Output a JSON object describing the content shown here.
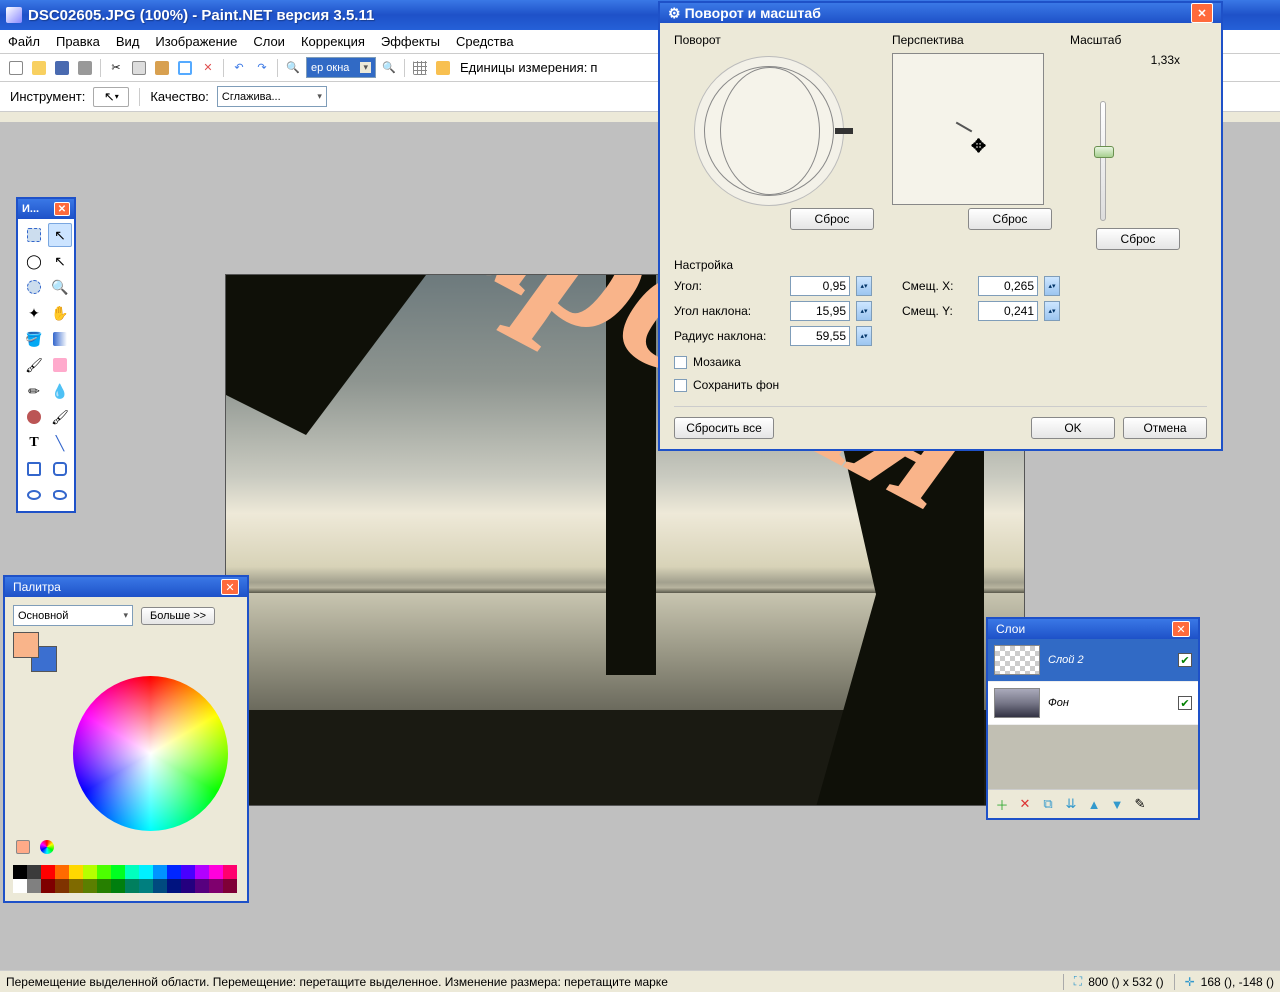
{
  "main_title": "DSC02605.JPG (100%) - Paint.NET версия 3.5.11",
  "menu": {
    "file": "Файл",
    "edit": "Правка",
    "view": "Вид",
    "image": "Изображение",
    "layers": "Слои",
    "adjust": "Коррекция",
    "effects": "Эффекты",
    "tools": "Средства"
  },
  "toolbar": {
    "zoom_value": "ер окна",
    "units_label": "Единицы измерения:",
    "units_short": "п"
  },
  "toolbar2": {
    "instrument": "Инструмент:",
    "quality": "Качество:",
    "quality_value": "Сглажива..."
  },
  "canvas_text": "Карелия",
  "tools_panel": {
    "title": "И..."
  },
  "colors": {
    "title": "Палитра",
    "primary_label": "Основной",
    "more": "Больше >>",
    "primary": "#f9b48a",
    "secondary": "#3b6fd0",
    "palette": [
      "#000000",
      "#3b3b3b",
      "#ff0000",
      "#ff6a00",
      "#ffd800",
      "#b6ff00",
      "#4cff00",
      "#00ff21",
      "#00ffbe",
      "#00f0ff",
      "#0094ff",
      "#0026ff",
      "#4800ff",
      "#b200ff",
      "#ff00dc",
      "#ff006e",
      "#ffffff",
      "#808080",
      "#7f0000",
      "#7f3300",
      "#7f6a00",
      "#5b7f00",
      "#267f00",
      "#007f0e",
      "#007f5e",
      "#007f7f",
      "#004a7f",
      "#00137f",
      "#24007f",
      "#57007f",
      "#7f006e",
      "#7f0037"
    ]
  },
  "layers": {
    "title": "Слои",
    "layer2": "Слой 2",
    "background": "Фон"
  },
  "dialog": {
    "title": "Поворот и масштаб",
    "rotation": "Поворот",
    "perspective": "Перспектива",
    "scale": "Масштаб",
    "scale_value": "1,33x",
    "reset": "Сброс",
    "settings": "Настройка",
    "angle": "Угол:",
    "angle_v": "0,95",
    "tilt_angle": "Угол наклона:",
    "tilt_angle_v": "15,95",
    "tilt_radius": "Радиус наклона:",
    "tilt_radius_v": "59,55",
    "offset_x": "Смещ. X:",
    "offset_x_v": "0,265",
    "offset_y": "Смещ. Y:",
    "offset_y_v": "0,241",
    "mosaic": "Мозаика",
    "keep_bg": "Сохранить фон",
    "reset_all": "Сбросить все",
    "ok": "OK",
    "cancel": "Отмена"
  },
  "status": {
    "hint": "Перемещение выделенной области. Перемещение: перетащите выделенное. Изменение размера: перетащите марке",
    "size": "800 () x 532 ()",
    "pos": "168 (), -148 ()"
  }
}
